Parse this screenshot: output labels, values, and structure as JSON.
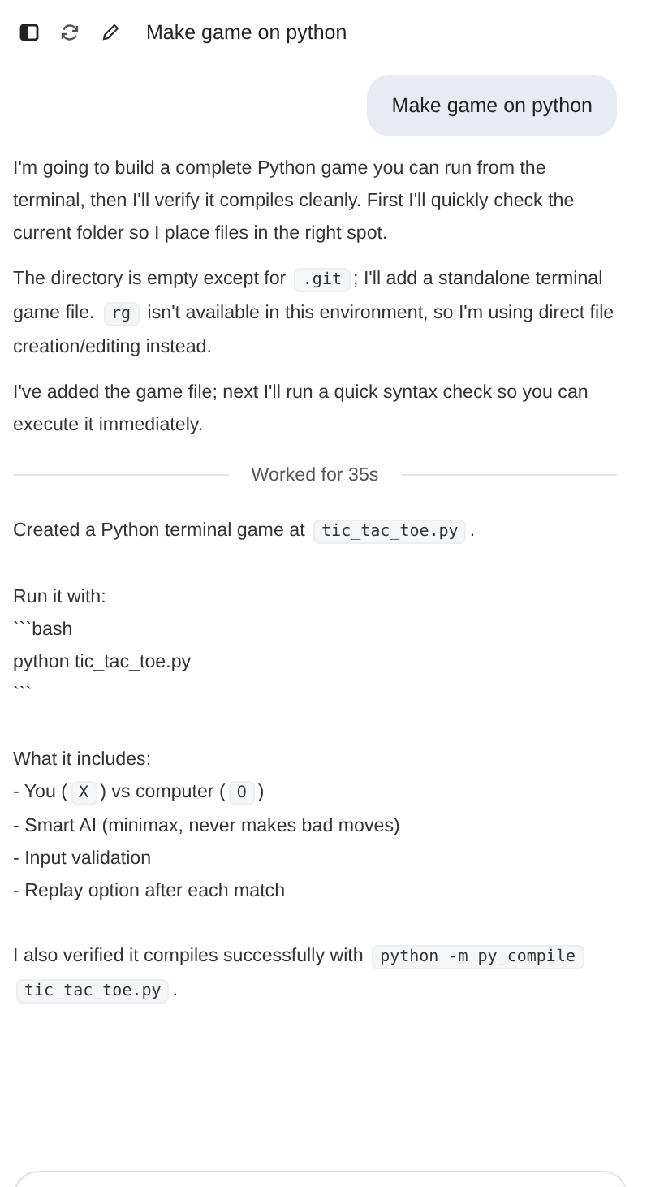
{
  "header": {
    "title": "Make game on python"
  },
  "user_message": "Make game on python",
  "blocks": [
    {
      "kind": "para",
      "segments": [
        {
          "kind": "text",
          "text": "I'm going to build a complete Python game you can run from the terminal, then I'll verify it compiles cleanly. First I'll quickly check the current folder so I place files in the right spot."
        }
      ]
    },
    {
      "kind": "para",
      "segments": [
        {
          "kind": "text",
          "text": "The directory is empty except for "
        },
        {
          "kind": "code",
          "text": ".git"
        },
        {
          "kind": "text",
          "text": "; I'll add a standalone terminal game file. "
        },
        {
          "kind": "code",
          "text": "rg"
        },
        {
          "kind": "text",
          "text": " isn't available in this environment, so I'm using direct file creation/editing instead."
        }
      ]
    },
    {
      "kind": "para",
      "segments": [
        {
          "kind": "text",
          "text": "I've added the game file; next I'll run a quick syntax check so you can execute it immediately."
        }
      ]
    },
    {
      "kind": "divider",
      "label": "Worked for 35s"
    },
    {
      "kind": "para",
      "segments": [
        {
          "kind": "text",
          "text": "Created a Python terminal game at "
        },
        {
          "kind": "code",
          "text": "tic_tac_toe.py"
        },
        {
          "kind": "text",
          "text": "."
        }
      ]
    },
    {
      "kind": "lines",
      "lines": [
        [
          {
            "kind": "text",
            "text": "Run it with:"
          }
        ],
        [
          {
            "kind": "text",
            "text": "```bash"
          }
        ],
        [
          {
            "kind": "text",
            "text": "python tic_tac_toe.py"
          }
        ],
        [
          {
            "kind": "text",
            "text": "```"
          }
        ]
      ]
    },
    {
      "kind": "lines",
      "lines": [
        [
          {
            "kind": "text",
            "text": "What it includes:"
          }
        ],
        [
          {
            "kind": "text",
            "text": "- You ("
          },
          {
            "kind": "code",
            "text": "X"
          },
          {
            "kind": "text",
            "text": ") vs computer ("
          },
          {
            "kind": "code",
            "text": "O"
          },
          {
            "kind": "text",
            "text": ")"
          }
        ],
        [
          {
            "kind": "text",
            "text": "- Smart AI (minimax, never makes bad moves)"
          }
        ],
        [
          {
            "kind": "text",
            "text": "- Input validation"
          }
        ],
        [
          {
            "kind": "text",
            "text": "- Replay option after each match"
          }
        ]
      ]
    },
    {
      "kind": "para",
      "segments": [
        {
          "kind": "text",
          "text": "I also verified it compiles successfully with "
        },
        {
          "kind": "code",
          "text": "python -m py_compile tic_tac_toe.py"
        },
        {
          "kind": "text",
          "text": "."
        }
      ]
    }
  ]
}
